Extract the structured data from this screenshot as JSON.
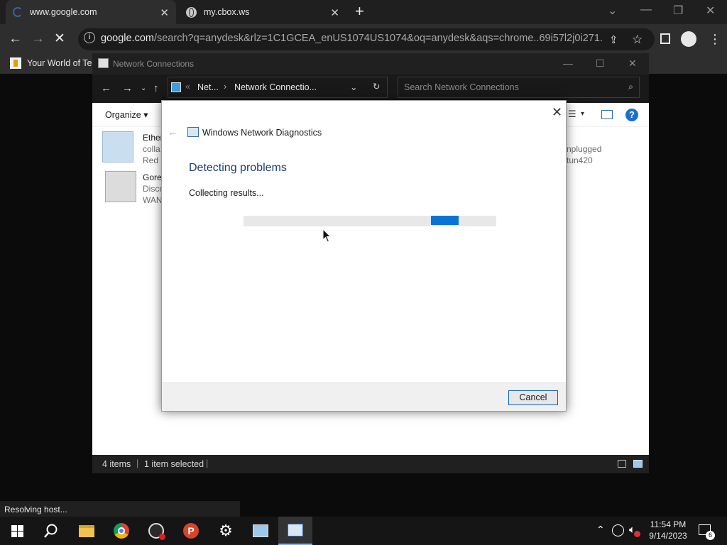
{
  "browser": {
    "tabs": [
      {
        "title": "www.google.com"
      },
      {
        "title": "my.cbox.ws"
      }
    ],
    "url": "google.com",
    "url_rest": "/search?q=anydesk&rlz=1C1GCEA_enUS1074US1074&oq=anydesk&aqs=chrome..69i57l2j0i271.173...",
    "bookmark": "Your World of Tex",
    "status_text": "Resolving host..."
  },
  "explorer": {
    "title": "Network Connections",
    "breadcrumb_1": "Net...",
    "breadcrumb_2": "Network Connectio...",
    "search_placeholder": "Search Network Connections",
    "organize_label": "Organize",
    "adapters": [
      {
        "name": "Ether",
        "line2": "colla",
        "line3": "Red H"
      },
      {
        "name": "Gore",
        "line2": "Disco",
        "line3": "WAN"
      }
    ],
    "right_text_1": "nplugged",
    "right_text_2": "tun420",
    "status_items": "4 items",
    "status_selected": "1 item selected"
  },
  "dialog": {
    "title": "Windows Network Diagnostics",
    "heading": "Detecting problems",
    "status": "Collecting results...",
    "progress": 0.834,
    "cancel_label": "Cancel"
  },
  "taskbar": {
    "time": "11:54 PM",
    "date": "9/14/2023",
    "notification_count": "6"
  },
  "colors": {
    "accent": "#0a74d4",
    "heading": "#1f3d74",
    "taskbar": "#151515"
  }
}
